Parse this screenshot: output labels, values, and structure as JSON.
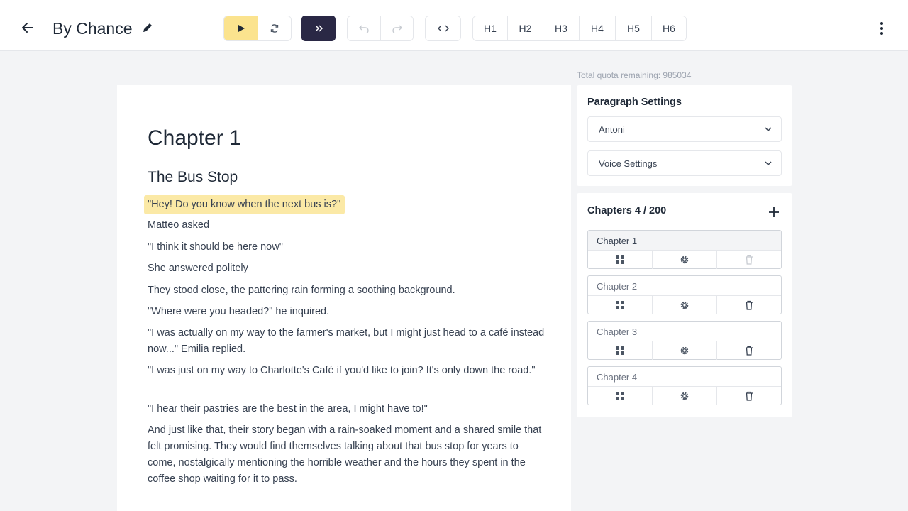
{
  "header": {
    "title": "By Chance",
    "toolbar": {
      "headings": [
        "H1",
        "H2",
        "H3",
        "H4",
        "H5",
        "H6"
      ]
    }
  },
  "quota": "Total quota remaining: 985034",
  "editor": {
    "chapter_heading": "Chapter 1",
    "sub_heading": "The Bus Stop",
    "paragraphs": [
      "\"Hey! Do you know when the next bus is?\"",
      "Matteo asked",
      "\"I think it should be here now\"",
      "She answered politely",
      "They stood close, the pattering rain forming a soothing background.",
      "\"Where were you headed?\" he inquired.",
      "\"I was actually on my way to the farmer's market, but I might just head to a café instead now...\" Emilia replied.",
      "\"I was just on my way to Charlotte's Café if you'd like to join? It's only down the road.\"",
      "\"I hear their pastries are the best in the area, I might have to!\"",
      "And just like that, their story began with a rain-soaked moment and a shared smile that felt promising. They would find themselves talking about that bus stop for years to come, nostalgically mentioning the horrible weather and the hours they spent in the coffee shop waiting for it to pass."
    ]
  },
  "paragraph_settings": {
    "title": "Paragraph Settings",
    "voice": "Antoni",
    "voice_settings": "Voice Settings"
  },
  "chapters": {
    "title": "Chapters 4 / 200",
    "items": [
      {
        "label": "Chapter 1"
      },
      {
        "label": "Chapter 2"
      },
      {
        "label": "Chapter 3"
      },
      {
        "label": "Chapter 4"
      }
    ]
  },
  "colors": {
    "accent_yellow": "#fbe38e",
    "highlight": "#fbe9a6",
    "dark_button": "#2a2845",
    "background": "#f3f4f6"
  }
}
